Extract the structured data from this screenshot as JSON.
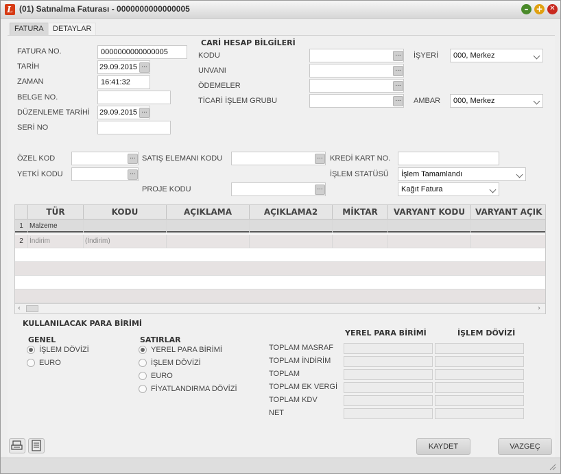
{
  "window": {
    "title": "(01) Satınalma Faturası - 0000000000000005",
    "min_glyph": "–",
    "max_glyph": "+",
    "close_glyph": "✕"
  },
  "tabs": [
    {
      "label": "FATURA"
    },
    {
      "label": "DETAYLAR"
    }
  ],
  "fatura": {
    "fatura_no_label": "FATURA NO.",
    "fatura_no_value": "0000000000000005",
    "tarih_label": "TARİH",
    "tarih_value": "29.09.2015",
    "zaman_label": "ZAMAN",
    "zaman_value": "16:41:32",
    "belge_no_label": "BELGE NO.",
    "belge_no_value": "",
    "duzenleme_tarihi_label": "DÜZENLEME TARİHİ",
    "duzenleme_tarihi_value": "29.09.2015",
    "seri_no_label": "SERİ NO",
    "seri_no_value": ""
  },
  "cari": {
    "header": "CARİ HESAP BİLGİLERİ",
    "kodu_label": "KODU",
    "unvani_label": "UNVANI",
    "odemeler_label": "ÖDEMELER",
    "ticari_label": "TİCARİ İŞLEM GRUBU",
    "isyeri_label": "İŞYERİ",
    "isyeri_value": "000, Merkez",
    "ambar_label": "AMBAR",
    "ambar_value": "000, Merkez"
  },
  "extra": {
    "ozel_kod_label": "ÖZEL KOD",
    "yetki_kodu_label": "YETKİ KODU",
    "satis_elemani_label": "SATIŞ ELEMANI KODU",
    "proje_kodu_label": "PROJE KODU",
    "kredi_kart_label": "KREDİ KART NO.",
    "islem_statusu_label": "İŞLEM STATÜSÜ",
    "islem_statusu_value": "İşlem Tamamlandı",
    "belge_turu_value": "Kağıt Fatura"
  },
  "lookup_glyph": "...",
  "grid": {
    "columns": [
      "TÜR",
      "KODU",
      "AÇIKLAMA",
      "AÇIKLAMA2",
      "MİKTAR",
      "VARYANT KODU",
      "VARYANT AÇIK"
    ],
    "rows": [
      {
        "num": "1",
        "tur": "Malzeme",
        "kodu": ""
      },
      {
        "num": "2",
        "tur": "İndirim",
        "kodu": "(İndirim)"
      }
    ],
    "scroll_left": "‹",
    "scroll_right": "›"
  },
  "currency": {
    "header": "KULLANILACAK PARA BİRİMİ",
    "genel_label": "GENEL",
    "genel_options": [
      {
        "label": "İŞLEM DÖVİZİ",
        "selected": true
      },
      {
        "label": "EURO",
        "selected": false
      }
    ],
    "satirlar_label": "SATIRLAR",
    "satirlar_options": [
      {
        "label": "YEREL PARA BİRİMİ",
        "selected": true
      },
      {
        "label": "İŞLEM DÖVİZİ",
        "selected": false
      },
      {
        "label": "EURO",
        "selected": false
      },
      {
        "label": "FİYATLANDIRMA DÖVİZİ",
        "selected": false
      }
    ]
  },
  "totals": {
    "col_yerel": "YEREL PARA BİRİMİ",
    "col_islem": "İŞLEM DÖVİZİ",
    "rows": [
      {
        "label": "TOPLAM MASRAF"
      },
      {
        "label": "TOPLAM İNDİRİM"
      },
      {
        "label": "TOPLAM"
      },
      {
        "label": "TOPLAM EK VERGİ"
      },
      {
        "label": "TOPLAM KDV"
      },
      {
        "label": "NET"
      }
    ]
  },
  "buttons": {
    "kaydet": "KAYDET",
    "vazgec": "VAZGEÇ"
  },
  "icons": [
    "printer-icon",
    "document-icon",
    "lookup-icon",
    "chevron-down-icon",
    "resize-grip-icon"
  ]
}
